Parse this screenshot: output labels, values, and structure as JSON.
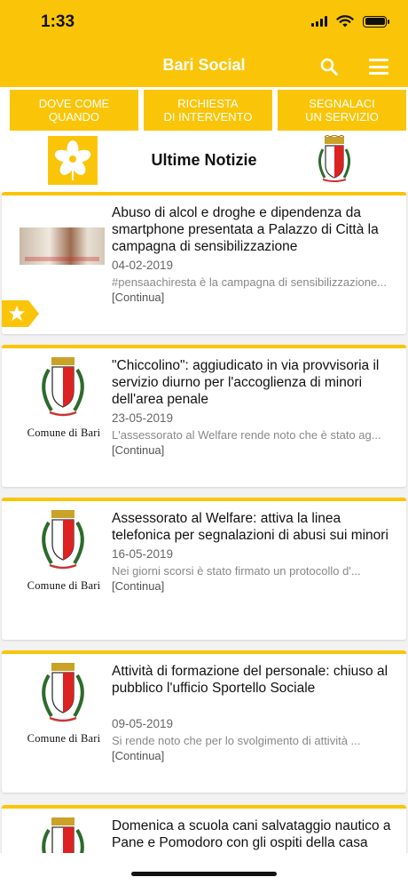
{
  "status_bar": {
    "time": "1:33"
  },
  "header": {
    "title": "Bari Social",
    "icons": {
      "search": "search-icon",
      "menu": "hamburger-menu-icon"
    },
    "accent_color": "#fac508"
  },
  "top_buttons": [
    {
      "label": "DOVE COME\nQUANDO"
    },
    {
      "label": "RICHIESTA\nDI INTERVENTO"
    },
    {
      "label": "SEGNALACI\nUN SERVIZIO"
    }
  ],
  "news_section": {
    "title": "Ultime Notizie"
  },
  "comune_label": "Comune di Bari",
  "news": [
    {
      "headline": "Abuso di alcol e droghe e dipendenza da smartphone presentata a Palazzo di Città la campagna di sensibilizzazione",
      "date": "04-02-2019",
      "excerpt": "#pensaachiresta è la campagna di sensibilizzazione...",
      "more": "[Continua]",
      "starred": true
    },
    {
      "headline": "\"Chiccolino\": aggiudicato in via provvisoria il servizio diurno per l'accoglienza di minori dell'area penale",
      "date": "23-05-2019",
      "excerpt": "L'assessorato al Welfare rende noto che è stato ag...",
      "more": "[Continua]"
    },
    {
      "headline": "Assessorato al Welfare: attiva la linea telefonica per segnalazioni di abusi sui minori",
      "date": "16-05-2019",
      "excerpt": "Nei giorni scorsi è stato firmato un protocollo d'...",
      "more": "[Continua]"
    },
    {
      "headline": "Attività di formazione del personale: chiuso al pubblico l'ufficio Sportello Sociale",
      "date": "09-05-2019",
      "excerpt": "Si rende  noto che per lo svolgimento di attività ...",
      "more": "[Continua]"
    },
    {
      "headline": "Domenica a scuola cani salvataggio nautico a Pane e Pomodoro con gli ospiti della casa",
      "date": "",
      "excerpt": "",
      "more": ""
    }
  ]
}
